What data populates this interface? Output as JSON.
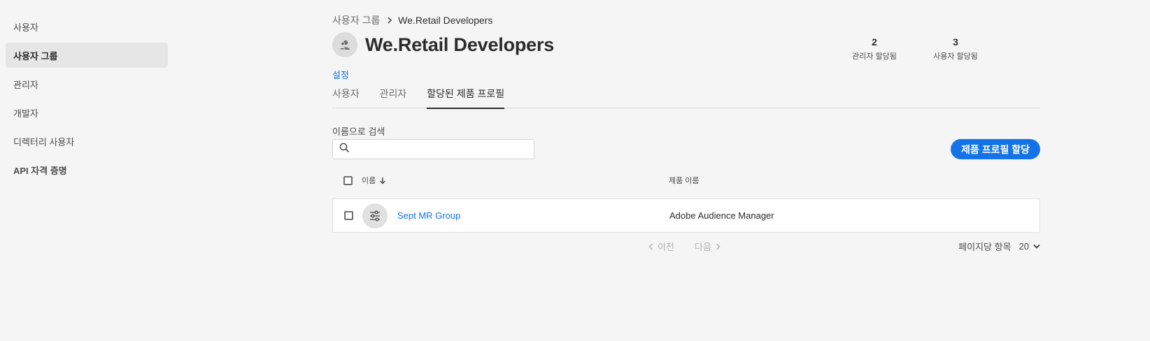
{
  "sidebar": {
    "items": [
      {
        "label": "사용자"
      },
      {
        "label": "사용자 그룹"
      },
      {
        "label": "관리자"
      },
      {
        "label": "개발자"
      },
      {
        "label": "디렉터리 사용자"
      },
      {
        "label": "API 자격 증명"
      }
    ]
  },
  "breadcrumb": {
    "parent": "사용자 그룹",
    "current": "We.Retail Developers"
  },
  "header": {
    "title": "We.Retail Developers",
    "stats": [
      {
        "value": "2",
        "label": "관리자 할당됨"
      },
      {
        "value": "3",
        "label": "사용자 할당됨"
      }
    ],
    "settings_link": "설정"
  },
  "tabs": [
    {
      "label": "사용자"
    },
    {
      "label": "관리자"
    },
    {
      "label": "할당된 제품 프로필"
    }
  ],
  "search": {
    "label": "이름으로 검색",
    "value": "",
    "placeholder": ""
  },
  "assign_button": "제품 프로필 할당",
  "table": {
    "columns": {
      "name": "이름",
      "product": "제품 이름"
    },
    "rows": [
      {
        "name": "Sept MR Group",
        "product": "Adobe Audience Manager"
      }
    ]
  },
  "pagination": {
    "prev": "이전",
    "next": "다음",
    "per_page_label": "페이지당 항목",
    "per_page_value": "20"
  },
  "colors": {
    "accent": "#1473e6",
    "background": "#f5f5f5",
    "sidebar_active": "#e6e6e6"
  }
}
